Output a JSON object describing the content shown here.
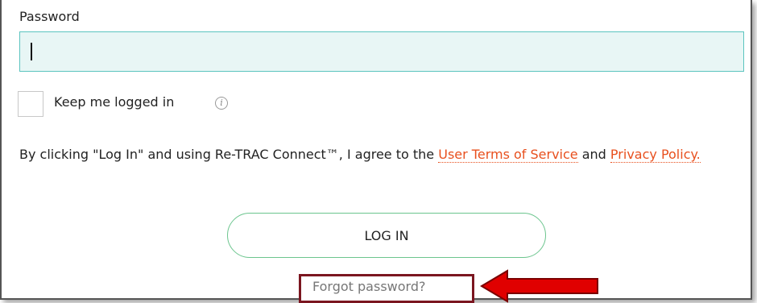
{
  "password": {
    "label": "Password",
    "value": "",
    "placeholder": ""
  },
  "keep_logged_in": {
    "label": "Keep me logged in",
    "checked": false,
    "info_icon": "info-icon",
    "info_glyph": "i"
  },
  "terms": {
    "prefix": "By clicking \"Log In\" and using Re-TRAC Connect™, I agree to the ",
    "tos_link": "User Terms of Service",
    "middle": " and ",
    "privacy_link": "Privacy Policy."
  },
  "login_button": {
    "label": "LOG IN"
  },
  "forgot_password": {
    "label": "Forgot password?"
  },
  "annotation": {
    "arrow_icon": "left-arrow-icon",
    "arrow_color": "#e00000",
    "highlight_color": "#7b1620"
  },
  "colors": {
    "input_border": "#5cc4bf",
    "input_bg": "#e8f6f5",
    "link": "#e8501e",
    "button_border": "#6cc58e"
  }
}
